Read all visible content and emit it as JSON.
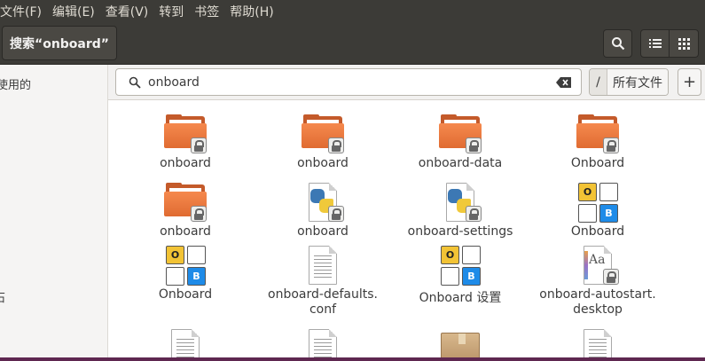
{
  "menu": [
    "文件(F)",
    "编辑(E)",
    "查看(V)",
    "转到",
    "书签",
    "帮助(H)"
  ],
  "header": {
    "path_label": "搜索“onboard”"
  },
  "sidebar": {
    "items": [
      "使用的",
      "石"
    ]
  },
  "search": {
    "query": "onboard",
    "location_slash": "/",
    "location_label": "所有文件",
    "add_label": "+"
  },
  "files": [
    {
      "label": "onboard",
      "icon": "folder-locked-icon"
    },
    {
      "label": "onboard",
      "icon": "folder-locked-icon"
    },
    {
      "label": "onboard-data",
      "icon": "folder-locked-icon"
    },
    {
      "label": "Onboard",
      "icon": "folder-locked-icon"
    },
    {
      "label": "onboard",
      "icon": "folder-locked-icon"
    },
    {
      "label": "onboard",
      "icon": "python-script-locked-icon"
    },
    {
      "label": "onboard-settings",
      "icon": "python-script-locked-icon"
    },
    {
      "label": "Onboard",
      "icon": "onboard-keyboard-icon"
    },
    {
      "label": "Onboard",
      "icon": "onboard-keyboard-icon"
    },
    {
      "label": "onboard-defaults.\nconf",
      "icon": "text-file-icon"
    },
    {
      "label": "Onboard 设置",
      "icon": "onboard-keyboard-icon"
    },
    {
      "label": "onboard-autostart.\ndesktop",
      "icon": "font-desktop-file-icon"
    },
    {
      "label": "",
      "icon": "text-file-icon"
    },
    {
      "label": "",
      "icon": "text-file-icon"
    },
    {
      "label": "",
      "icon": "package-box-icon"
    },
    {
      "label": "",
      "icon": "font-desktop-file-icon"
    }
  ],
  "keyboard_keys": {
    "o": "O",
    "b": "B"
  },
  "font_preview": "Aa",
  "colors": {
    "folder_orange": "#e06b31",
    "header_dark": "#3c3b37",
    "accent_purple": "#5e2750",
    "key_blue": "#1e8be8",
    "key_yellow": "#f2c335"
  }
}
